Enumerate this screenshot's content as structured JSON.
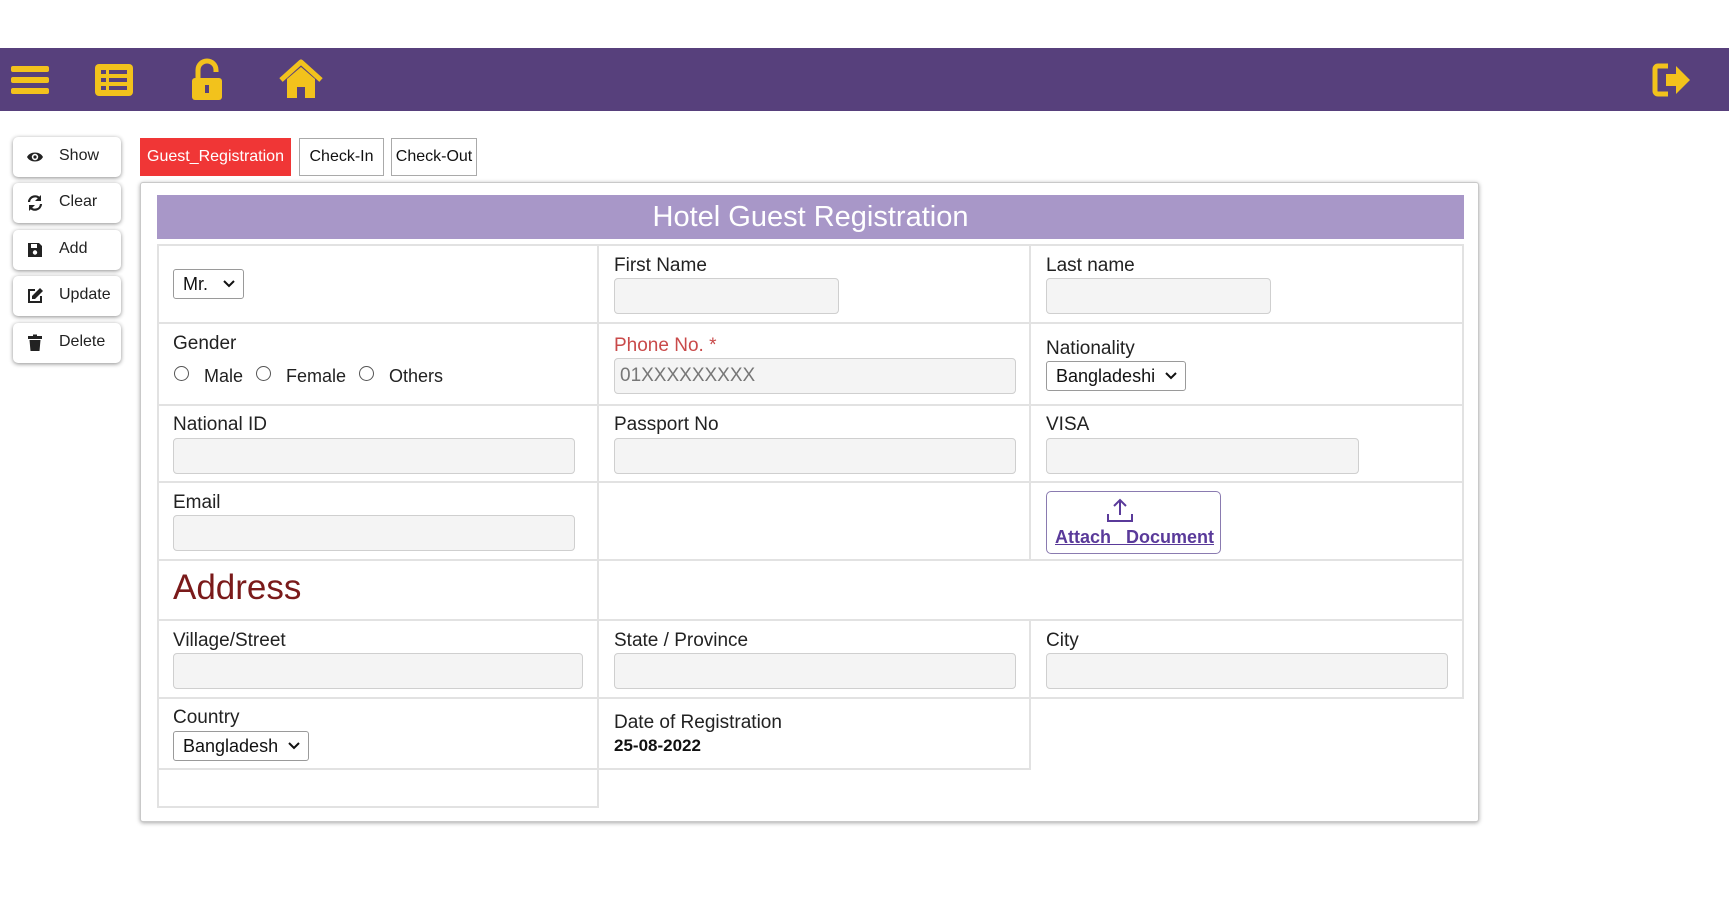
{
  "topbar": {
    "icons": [
      "menu-icon",
      "list-icon",
      "unlock-icon",
      "home-icon",
      "sign-out-icon"
    ],
    "background": "#57407c",
    "icon_color": "#f2c21c"
  },
  "sidebar": {
    "buttons": [
      {
        "label": "Show",
        "icon": "eye-icon"
      },
      {
        "label": "Clear",
        "icon": "refresh-icon"
      },
      {
        "label": "Add",
        "icon": "save-icon"
      },
      {
        "label": "Update",
        "icon": "edit-icon"
      },
      {
        "label": "Delete",
        "icon": "trash-icon"
      }
    ]
  },
  "tabs": [
    {
      "label": "Guest_Registration",
      "active": true
    },
    {
      "label": "Check-In",
      "active": false
    },
    {
      "label": "Check-Out",
      "active": false
    }
  ],
  "form": {
    "title": "Hotel Guest Registration",
    "salutation": {
      "value": "Mr."
    },
    "first_name": {
      "label": "First Name",
      "value": ""
    },
    "last_name": {
      "label": "Last name",
      "value": ""
    },
    "gender": {
      "label": "Gender",
      "options": [
        "Male",
        "Female",
        "Others"
      ],
      "selected": null
    },
    "phone": {
      "label": "Phone No. *",
      "placeholder": "01XXXXXXXXX",
      "required": true
    },
    "nationality": {
      "label": "Nationality",
      "value": "Bangladeshi"
    },
    "national_id": {
      "label": "National ID",
      "value": ""
    },
    "passport": {
      "label": "Passport No",
      "value": ""
    },
    "visa": {
      "label": "VISA",
      "value": ""
    },
    "email": {
      "label": "Email",
      "value": ""
    },
    "attach": {
      "label": "Attach   Document",
      "icon": "upload-icon"
    },
    "address_heading": "Address",
    "village": {
      "label": "Village/Street",
      "value": ""
    },
    "state": {
      "label": "State / Province",
      "value": ""
    },
    "city": {
      "label": "City",
      "value": ""
    },
    "country": {
      "label": "Country",
      "value": "Bangladesh"
    },
    "registration_date": {
      "label": "Date of Registration",
      "value": "25-08-2022"
    }
  },
  "colors": {
    "active_tab": "#f03636",
    "title_bar": "#a897c8",
    "required_label": "#c94a4a",
    "address_heading": "#7a1a1a",
    "attach_link": "#5a3a9a"
  }
}
